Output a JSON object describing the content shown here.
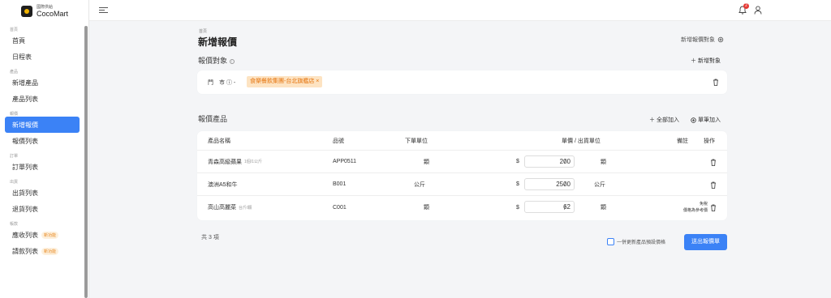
{
  "brand": {
    "sub": "國際供給",
    "name": "CocoMart"
  },
  "sidebar": {
    "sections": [
      {
        "title": "首頁",
        "items": [
          {
            "label": "首頁"
          },
          {
            "label": "日程表"
          }
        ]
      },
      {
        "title": "產品",
        "items": [
          {
            "label": "新增產品"
          },
          {
            "label": "產品列表"
          }
        ]
      },
      {
        "title": "報價",
        "items": [
          {
            "label": "新增報價",
            "active": true
          },
          {
            "label": "報價列表"
          }
        ]
      },
      {
        "title": "訂單",
        "items": [
          {
            "label": "訂單列表"
          }
        ]
      },
      {
        "title": "出貨",
        "items": [
          {
            "label": "出貨列表"
          },
          {
            "label": "退貨列表"
          }
        ]
      },
      {
        "title": "帳款",
        "items": [
          {
            "label": "應收列表",
            "badge": "新功能"
          },
          {
            "label": "請款列表",
            "badge": "新功能"
          }
        ]
      }
    ]
  },
  "header": {
    "notification_count": "2"
  },
  "page": {
    "breadcrumb": "首頁",
    "title": "新增報價",
    "top_link": "新增報價對象",
    "target_section_title": "報價對象",
    "add_target": "＋ 新增對象",
    "target_label": "門　市 ⓘ -",
    "target_tag": "食樂餐飲集團-台北旗艦店 ×",
    "product_section_title": "報價產品",
    "add_all": "＋ 全部加入",
    "add_single": "單筆加入",
    "total": "共 3 項",
    "checkbox_label": "一併更新產品預設價格",
    "submit": "送出報價單"
  },
  "table": {
    "headers": {
      "name": "產品名稱",
      "code": "品號",
      "unit": "下單單位",
      "price": "單價 / 出貨單位",
      "note": "備註",
      "action": "操作"
    },
    "rows": [
      {
        "name": "青森高級蘋果",
        "spec": "1個/1公斤",
        "code": "APP0511",
        "unit": "顆",
        "price": "200",
        "ship_unit": "顆",
        "note": ""
      },
      {
        "name": "澳洲A5和牛",
        "spec": "",
        "code": "B001",
        "unit": "公斤",
        "price": "2500",
        "ship_unit": "公斤",
        "note": ""
      },
      {
        "name": "高山高麗菜",
        "spec": "台斤/顆",
        "code": "C001",
        "unit": "顆",
        "price": "62",
        "ship_unit": "顆",
        "note": "免稅\n價格為參考價"
      }
    ],
    "currency": "$"
  }
}
